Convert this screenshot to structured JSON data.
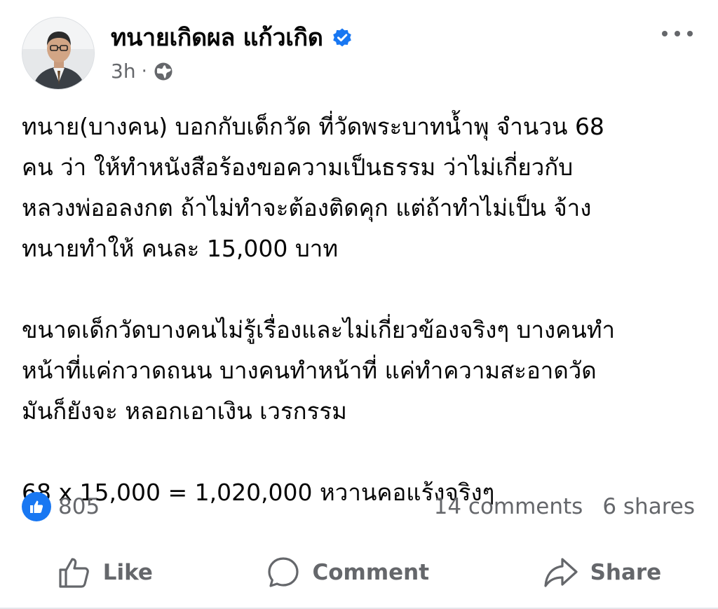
{
  "post": {
    "author": "ทนายเกิดผล แก้วเกิด",
    "time": "3h",
    "separator": "·",
    "audience_icon": "globe-icon",
    "more_icon": "more-horizontal-icon",
    "paragraphs": [
      {
        "lines": [
          "ทนาย(บางคน) บอกกับเด็กวัด ที่วัดพระบาทน้ำพุ จำนวน  68",
          "คน ว่า ให้ทำหนังสือร้องขอความเป็นธรรม ว่าไม่เกี่ยวกับ",
          "หลวงพ่ออลงกต ถ้าไม่ทำจะต้องติดคุก แต่ถ้าทำไม่เป็น จ้าง",
          "ทนายทำให้ คนละ 15,000 บาท"
        ]
      },
      {
        "lines": [
          "ขนาดเด็กวัดบางคนไม่รู้เรื่องและไม่เกี่ยวข้องจริงๆ บางคนทำ",
          "หน้าที่แค่กวาดถนน  บางคนทำหน้าที่ แค่ทำความสะอาดวัด",
          "มันก็ยังจะ หลอกเอาเงิน เวรกรรม"
        ]
      },
      {
        "lines": [
          "68 x 15,000 = 1,020,000  หวานคอแร้งจริงๆ"
        ]
      }
    ]
  },
  "stats": {
    "reactions_count": "805",
    "comments": "14 comments",
    "shares": "6 shares"
  },
  "actions": {
    "like": "Like",
    "comment": "Comment",
    "share": "Share"
  },
  "colors": {
    "brand_blue": "#1877f2",
    "secondary_text": "#65676b",
    "primary_text": "#050505"
  }
}
